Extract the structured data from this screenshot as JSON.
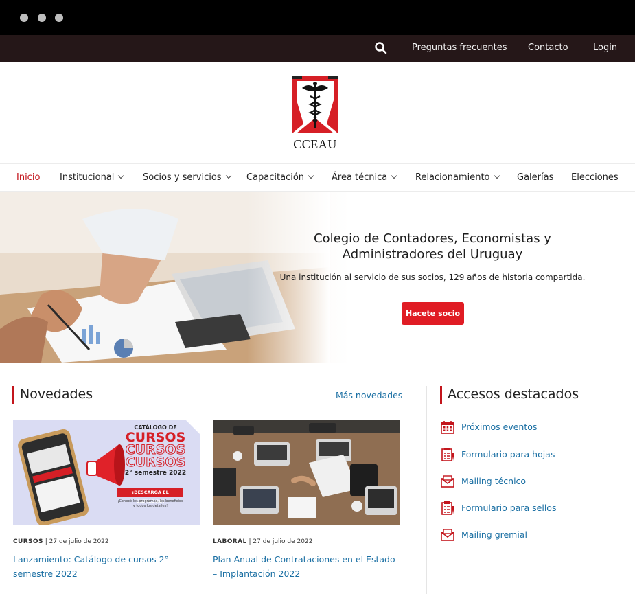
{
  "topbar": {
    "links": [
      "Preguntas frecuentes",
      "Contacto",
      "Login"
    ]
  },
  "logo": {
    "text": "CCEAU"
  },
  "nav": {
    "items": [
      {
        "label": "Inicio",
        "active": true
      },
      {
        "label": "Institucional",
        "dropdown": true
      },
      {
        "label": "Socios y servicios",
        "dropdown": true
      },
      {
        "label": "Capacitación",
        "dropdown": true
      },
      {
        "label": "Área técnica",
        "dropdown": true
      },
      {
        "label": "Relacionamiento",
        "dropdown": true
      },
      {
        "label": "Galerías"
      },
      {
        "label": "Elecciones"
      }
    ]
  },
  "hero": {
    "title": "Colegio de Contadores, Economistas y Administradores del Uruguay",
    "subtitle": "Una institución al servicio de sus socios, 129 años de historia compartida.",
    "cta": "Hacete socio"
  },
  "novedades": {
    "title": "Novedades",
    "more_link": "Más novedades",
    "cards": [
      {
        "category": "CURSOS",
        "date": "27 de julio de 2022",
        "title": "Lanzamiento: Catálogo de cursos 2° semestre 2022",
        "image": {
          "top": "CATÁLOGO DE",
          "word": "CURSOS",
          "semester": "2° semestre 2022",
          "badge": "¡DESCARGÁ EL CATÁLOGO!",
          "note": "¡Conocé los programas, los beneficios y todos los detalles!"
        }
      },
      {
        "category": "LABORAL",
        "date": "27 de julio de 2022",
        "title": "Plan Anual de Contrataciones en el Estado – Implantación 2022"
      }
    ]
  },
  "accesos": {
    "title": "Accesos destacados",
    "items": [
      {
        "label": "Próximos eventos",
        "icon": "calendar-icon"
      },
      {
        "label": "Formulario para hojas",
        "icon": "form-icon"
      },
      {
        "label": "Mailing técnico",
        "icon": "mail-icon"
      },
      {
        "label": "Formulario para sellos",
        "icon": "form-icon"
      },
      {
        "label": "Mailing gremial",
        "icon": "mail-icon"
      }
    ]
  },
  "colors": {
    "accent": "#c3151c",
    "button": "#e01c24",
    "link": "#1a6fa3",
    "topbar": "#251718"
  }
}
